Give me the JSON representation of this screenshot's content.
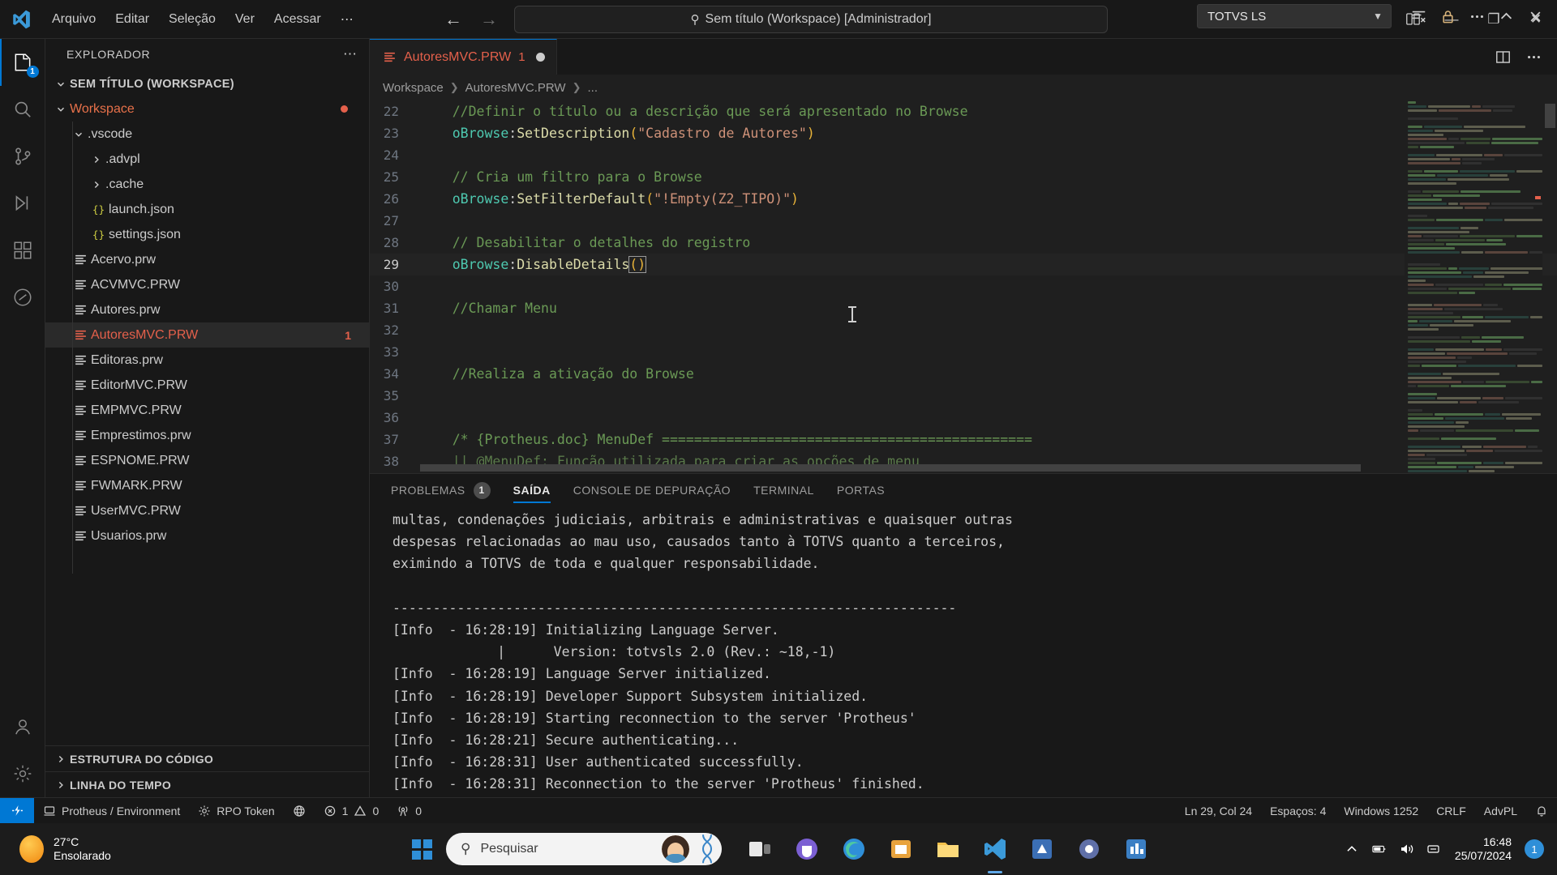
{
  "titlebar": {
    "menu": [
      "Arquivo",
      "Editar",
      "Seleção",
      "Ver",
      "Acessar",
      "⋯"
    ],
    "search_text": "Sem título (Workspace) [Administrador]",
    "back_label": "←",
    "forward_label": "→",
    "minimize": "—",
    "maximize": "❐",
    "close": "✕"
  },
  "activitybar": {
    "items": [
      {
        "name": "explorer",
        "badge": "1"
      },
      {
        "name": "search",
        "badge": ""
      },
      {
        "name": "source-control",
        "badge": ""
      },
      {
        "name": "run-debug",
        "badge": ""
      },
      {
        "name": "extensions",
        "badge": ""
      },
      {
        "name": "totvs",
        "badge": ""
      }
    ],
    "accounts": "accounts",
    "settings": "settings"
  },
  "sidebar": {
    "header_title": "EXPLORADOR",
    "header_more": "⋯",
    "root": "SEM TÍTULO (WORKSPACE)",
    "tree": [
      {
        "label": "Workspace",
        "kind": "folder",
        "depth": 1,
        "expanded": true,
        "color": "orange",
        "modified": true
      },
      {
        "label": ".vscode",
        "kind": "folder",
        "depth": 2,
        "expanded": true,
        "color": "normal"
      },
      {
        "label": ".advpl",
        "kind": "folder",
        "depth": 3,
        "expanded": false,
        "color": "normal"
      },
      {
        "label": ".cache",
        "kind": "folder",
        "depth": 3,
        "expanded": false,
        "color": "normal"
      },
      {
        "label": "launch.json",
        "kind": "json",
        "depth": 3,
        "color": "normal"
      },
      {
        "label": "settings.json",
        "kind": "json",
        "depth": 3,
        "color": "normal"
      },
      {
        "label": "Acervo.prw",
        "kind": "prw",
        "depth": 2,
        "color": "normal"
      },
      {
        "label": "ACVMVC.PRW",
        "kind": "prw",
        "depth": 2,
        "color": "normal"
      },
      {
        "label": "Autores.prw",
        "kind": "prw",
        "depth": 2,
        "color": "normal"
      },
      {
        "label": "AutoresMVC.PRW",
        "kind": "prw",
        "depth": 2,
        "color": "red",
        "selected": true,
        "badge": "1"
      },
      {
        "label": "Editoras.prw",
        "kind": "prw",
        "depth": 2,
        "color": "normal"
      },
      {
        "label": "EditorMVC.PRW",
        "kind": "prw",
        "depth": 2,
        "color": "normal"
      },
      {
        "label": "EMPMVC.PRW",
        "kind": "prw",
        "depth": 2,
        "color": "normal"
      },
      {
        "label": "Emprestimos.prw",
        "kind": "prw",
        "depth": 2,
        "color": "normal"
      },
      {
        "label": "ESPNOME.PRW",
        "kind": "prw",
        "depth": 2,
        "color": "normal"
      },
      {
        "label": "FWMARK.PRW",
        "kind": "prw",
        "depth": 2,
        "color": "normal"
      },
      {
        "label": "UserMVC.PRW",
        "kind": "prw",
        "depth": 2,
        "color": "normal"
      },
      {
        "label": "Usuarios.prw",
        "kind": "prw",
        "depth": 2,
        "color": "normal"
      }
    ],
    "sections": [
      "ESTRUTURA DO CÓDIGO",
      "LINHA DO TEMPO"
    ]
  },
  "editor": {
    "tab": {
      "name": "AutoresMVC.PRW",
      "problem_count": "1",
      "dirty": true
    },
    "breadcrumb": [
      "Workspace",
      "AutoresMVC.PRW",
      "..."
    ],
    "lines": [
      {
        "n": "22",
        "tokens": [
          {
            "t": "    //Definir o título ou a descrição que será apresentado no Browse",
            "c": "c-comment"
          }
        ]
      },
      {
        "n": "23",
        "tokens": [
          {
            "t": "    ",
            "c": "c-punct"
          },
          {
            "t": "oBrowse",
            "c": "c-var"
          },
          {
            "t": ":",
            "c": "c-punct"
          },
          {
            "t": "SetDescription",
            "c": "c-method"
          },
          {
            "t": "(",
            "c": "c-paren"
          },
          {
            "t": "\"Cadastro de Autores\"",
            "c": "c-str"
          },
          {
            "t": ")",
            "c": "c-paren"
          }
        ]
      },
      {
        "n": "24",
        "tokens": []
      },
      {
        "n": "25",
        "tokens": [
          {
            "t": "    // Cria um filtro para o Browse",
            "c": "c-comment"
          }
        ]
      },
      {
        "n": "26",
        "tokens": [
          {
            "t": "    ",
            "c": "c-punct"
          },
          {
            "t": "oBrowse",
            "c": "c-var"
          },
          {
            "t": ":",
            "c": "c-punct"
          },
          {
            "t": "SetFilterDefault",
            "c": "c-method"
          },
          {
            "t": "(",
            "c": "c-paren"
          },
          {
            "t": "\"!Empty(Z2_TIPO)\"",
            "c": "c-str"
          },
          {
            "t": ")",
            "c": "c-paren"
          }
        ]
      },
      {
        "n": "27",
        "tokens": []
      },
      {
        "n": "28",
        "tokens": [
          {
            "t": "    // Desabilitar o detalhes do registro",
            "c": "c-comment"
          }
        ]
      },
      {
        "n": "29",
        "current": true,
        "tokens": [
          {
            "t": "    ",
            "c": "c-punct"
          },
          {
            "t": "oBrowse",
            "c": "c-var"
          },
          {
            "t": ":",
            "c": "c-punct"
          },
          {
            "t": "DisableDetails",
            "c": "c-method"
          },
          {
            "t": "()",
            "c": "c-paren",
            "box": true
          }
        ]
      },
      {
        "n": "30",
        "tokens": []
      },
      {
        "n": "31",
        "tokens": [
          {
            "t": "    //Chamar Menu",
            "c": "c-comment"
          }
        ]
      },
      {
        "n": "32",
        "tokens": []
      },
      {
        "n": "33",
        "tokens": []
      },
      {
        "n": "34",
        "tokens": [
          {
            "t": "    //Realiza a ativação do Browse",
            "c": "c-comment"
          }
        ]
      },
      {
        "n": "35",
        "tokens": []
      },
      {
        "n": "36",
        "tokens": []
      },
      {
        "n": "37",
        "tokens": [
          {
            "t": "    /* {Protheus.doc} MenuDef ==============================================",
            "c": "c-doc"
          }
        ]
      },
      {
        "n": "38",
        "tokens": [
          {
            "t": "    || @MenuDef: Função utilizada para criar as opções de menu",
            "c": "c-docdim"
          }
        ]
      }
    ]
  },
  "panel": {
    "tabs": [
      {
        "label": "PROBLEMAS",
        "badge": "1",
        "active": false
      },
      {
        "label": "SAÍDA",
        "badge": "",
        "active": true
      },
      {
        "label": "CONSOLE DE DEPURAÇÃO",
        "badge": "",
        "active": false
      },
      {
        "label": "TERMINAL",
        "badge": "",
        "active": false
      },
      {
        "label": "PORTAS",
        "badge": "",
        "active": false
      }
    ],
    "select_value": "TOTVS LS",
    "actions": [
      "clear-output-icon",
      "lock-icon",
      "more-icon",
      "maximize-panel-icon",
      "close-panel-icon"
    ],
    "output": [
      "multas, condenações judiciais, arbitrais e administrativas e quaisquer outras",
      "despesas relacionadas ao mau uso, causados tanto à TOTVS quanto a terceiros,",
      "eximindo a TOTVS de toda e qualquer responsabilidade.",
      "",
      "----------------------------------------------------------------------",
      "[Info  - 16:28:19] Initializing Language Server.",
      "             |      Version: totvsls 2.0 (Rev.: ~18,-1)",
      "[Info  - 16:28:19] Language Server initialized.",
      "[Info  - 16:28:19] Developer Support Subsystem initialized.",
      "[Info  - 16:28:19] Starting reconnection to the server 'Protheus'",
      "[Info  - 16:28:21] Secure authenticating...",
      "[Info  - 16:28:31] User authenticated successfully.",
      "[Info  - 16:28:31] Reconnection to the server 'Protheus' finished."
    ]
  },
  "statusbar": {
    "remote": "remote-icon",
    "left": [
      {
        "icon": "server-icon",
        "label": "Protheus / Environment"
      },
      {
        "icon": "gear-icon",
        "label": "RPO Token"
      },
      {
        "icon": "globe-icon",
        "label": ""
      },
      {
        "icon": "error-icon",
        "label": "1"
      },
      {
        "icon": "warning-icon",
        "label": "0"
      },
      {
        "icon": "radio-tower-icon",
        "label": "0"
      }
    ],
    "right": [
      {
        "label": "Ln 29, Col 24"
      },
      {
        "label": "Espaços: 4"
      },
      {
        "label": "Windows 1252"
      },
      {
        "label": "CRLF"
      },
      {
        "label": "AdvPL"
      },
      {
        "label": "",
        "icon": "bell-icon"
      }
    ]
  },
  "taskbar": {
    "weather_temp": "27°C",
    "weather_desc": "Ensolarado",
    "search_placeholder": "Pesquisar",
    "apps": [
      "task-view-icon",
      "teams-icon",
      "edge-icon",
      "store-icon",
      "explorer-icon",
      "vscode-icon",
      "app-blue-icon",
      "app-settings-icon",
      "app-chart-icon"
    ],
    "clock_time": "16:48",
    "clock_date": "25/07/2024",
    "notification_count": "1"
  },
  "colors": {
    "accent": "#0078d4",
    "modified": "#e4604b",
    "comment": "#6a9955",
    "string": "#ce9178",
    "method": "#dcdcaa",
    "variable": "#4ec9b0"
  }
}
